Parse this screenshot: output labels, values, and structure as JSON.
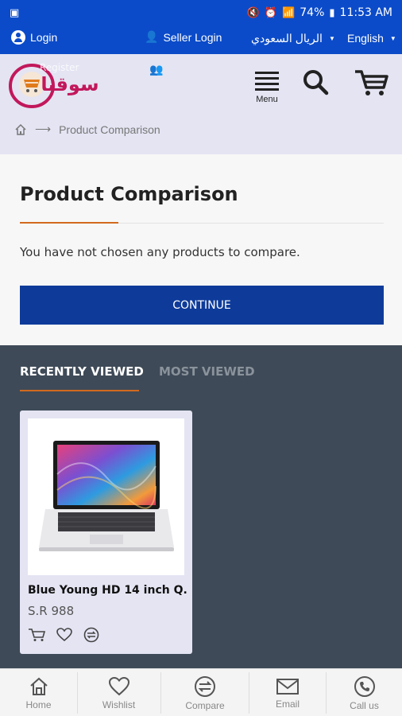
{
  "status": {
    "time": "11:53 AM",
    "battery": "74%"
  },
  "topbar": {
    "login_label": "Login",
    "seller_label": "Seller Login",
    "currency_label": "الريال السعودي",
    "language_label": "English"
  },
  "header": {
    "register_label": "Register",
    "logo_text": "سوقنا",
    "menu_label": "Menu"
  },
  "breadcrumb": {
    "current": "Product Comparison"
  },
  "main": {
    "title": "Product Comparison",
    "message": "You have not chosen any products to compare.",
    "continue_label": "CONTINUE"
  },
  "recent": {
    "tabs": [
      {
        "label": "RECENTLY VIEWED",
        "active": true
      },
      {
        "label": "MOST VIEWED",
        "active": false
      }
    ],
    "products": [
      {
        "name": "Blue Young HD 14 inch Q...",
        "price": "S.R 988"
      }
    ]
  },
  "bottom_nav": [
    {
      "label": "Home",
      "icon": "home-icon"
    },
    {
      "label": "Wishlist",
      "icon": "heart-icon"
    },
    {
      "label": "Compare",
      "icon": "compare-icon"
    },
    {
      "label": "Email",
      "icon": "mail-icon"
    },
    {
      "label": "Call us",
      "icon": "phone-icon"
    }
  ],
  "colors": {
    "primary_blue": "#0b4bc9",
    "button_blue": "#0e3b9a",
    "accent_orange": "#d2691e",
    "dark_panel": "#3e4a57",
    "header_lavender": "#e4e4f3"
  }
}
